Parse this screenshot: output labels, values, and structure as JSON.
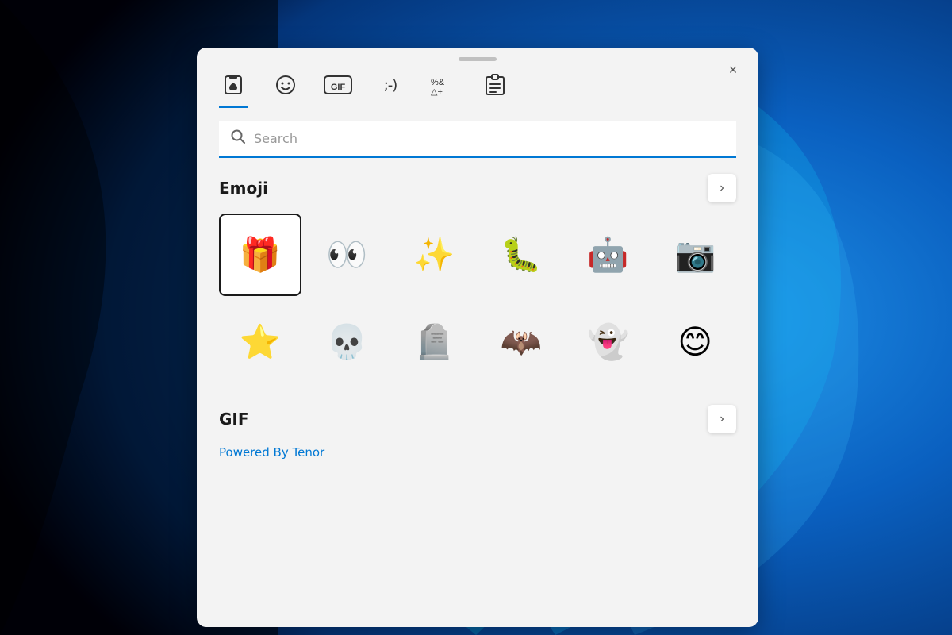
{
  "background": {
    "description": "Windows 11 blue swoosh wallpaper"
  },
  "panel": {
    "close_button_label": "×",
    "drag_handle_aria": "drag handle"
  },
  "tabs": [
    {
      "id": "favorites",
      "icon": "🗂",
      "label": "Favorites",
      "active": true,
      "icon_type": "heart-clipboard"
    },
    {
      "id": "emoji",
      "icon": "😊",
      "label": "Emoji",
      "active": false,
      "icon_type": "smiley"
    },
    {
      "id": "gif",
      "icon": "GIF",
      "label": "GIF",
      "active": false,
      "icon_type": "gif"
    },
    {
      "id": "kaomoji",
      "icon": ";-)",
      "label": "Kaomoji",
      "active": false,
      "icon_type": "kaomoji"
    },
    {
      "id": "symbols",
      "icon": "⌘",
      "label": "Symbols",
      "active": false,
      "icon_type": "symbols"
    },
    {
      "id": "clipboard",
      "icon": "📋",
      "label": "Clipboard",
      "active": false,
      "icon_type": "clipboard"
    }
  ],
  "search": {
    "placeholder": "Search",
    "value": ""
  },
  "emoji_section": {
    "title": "Emoji",
    "arrow_label": "›",
    "emojis": [
      {
        "char": "🎁",
        "name": "gift",
        "selected": true
      },
      {
        "char": "👀",
        "name": "eyes"
      },
      {
        "char": "✨",
        "name": "sparkles"
      },
      {
        "char": "🐛",
        "name": "caterpillar"
      },
      {
        "char": "🤖",
        "name": "robot"
      },
      {
        "char": "📷",
        "name": "camera-with-flash"
      },
      {
        "char": "⭐",
        "name": "star"
      },
      {
        "char": "💀",
        "name": "skull"
      },
      {
        "char": "🪦",
        "name": "headstone"
      },
      {
        "char": "🦇",
        "name": "bat"
      },
      {
        "char": "👻",
        "name": "ghost"
      },
      {
        "char": "😊",
        "name": "smiling-face"
      }
    ]
  },
  "gif_section": {
    "title": "GIF",
    "arrow_label": "›",
    "powered_by": "Powered By Tenor"
  }
}
